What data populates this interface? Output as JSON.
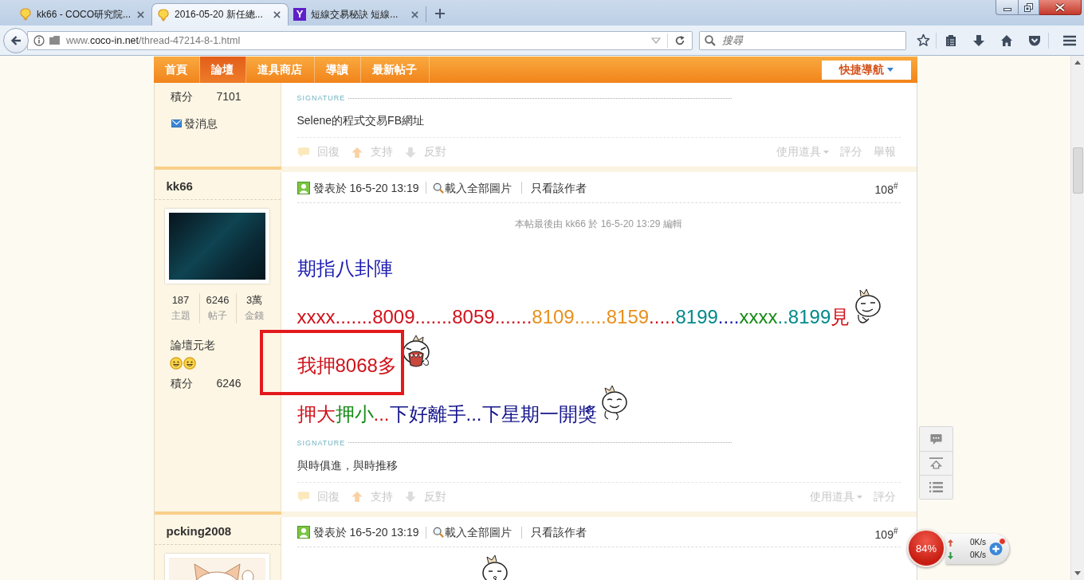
{
  "browser": {
    "tabs": [
      {
        "label": "kk66 - COCO研究院...",
        "selected": false
      },
      {
        "label": "2016-05-20 新任總...",
        "selected": true
      },
      {
        "label": "短線交易秘訣 短線...",
        "selected": false,
        "favicon_letter": "Y"
      }
    ],
    "address": {
      "prefix": "www.",
      "host": "coco-in.net",
      "path": "/thread-47214-8-1.html"
    },
    "search": {
      "placeholder": "搜尋"
    }
  },
  "nav": {
    "items": [
      {
        "label": "首頁",
        "selected": false
      },
      {
        "label": "論壇",
        "selected": true
      },
      {
        "label": "道具商店",
        "selected": false
      },
      {
        "label": "導讀",
        "selected": false
      },
      {
        "label": "最新帖子",
        "selected": false
      }
    ],
    "quick_nav": "快捷導航"
  },
  "posts": [
    {
      "author": {
        "points_label": "積分",
        "points": "7101",
        "message_link": "發消息"
      },
      "signature": {
        "label": "SIGNATURE",
        "text": "Selene的程式交易FB網址"
      },
      "actions": [
        {
          "kind": "reply",
          "label": "回復"
        },
        {
          "kind": "support",
          "label": "支持"
        },
        {
          "kind": "oppose",
          "label": "反對"
        }
      ],
      "tools": [
        {
          "label": "使用道具",
          "menu": true
        },
        {
          "label": "評分",
          "menu": false
        },
        {
          "label": "舉報",
          "menu": false
        }
      ]
    },
    {
      "author": {
        "name": "kk66",
        "avatar": {
          "kind": "photo"
        },
        "stats": [
          {
            "value": "187",
            "label": "主題"
          },
          {
            "value": "6246",
            "label": "帖子"
          },
          {
            "value": "3萬",
            "label": "金錢"
          }
        ],
        "rank": "論壇元老",
        "medals": [
          {
            "kind": "smiley"
          },
          {
            "kind": "smiley"
          }
        ],
        "points_label": "積分",
        "points": "6246"
      },
      "header": {
        "posted": "發表於 16-5-20 13:19",
        "load_images": "載入全部圖片",
        "author_only": "只看該作者",
        "floor": "108$^{#}$"
      },
      "edit_note": "本帖最後由 kk66 於 16-5-20 13:29 編輯",
      "body": [
        {
          "segments": [
            {
              "text": "期指八卦陣",
              "color": "#1a1ab0"
            }
          ],
          "highlighted": false
        },
        {
          "segments": [
            {
              "text": "xxxx.......8009.......8059.......",
              "color": "#d0121b"
            },
            {
              "text": "8109......8159",
              "color": "#e8901e"
            },
            {
              "text": ".....",
              "color": "#d0121b"
            },
            {
              "text": "8199",
              "color": "#008a8a"
            },
            {
              "text": "....",
              "color": "#1a1ab0"
            },
            {
              "text": "xxxx",
              "color": "#168a16"
            },
            {
              "text": "..8199",
              "color": "#008a8a"
            },
            {
              "text": "見",
              "color": "#d0121b"
            }
          ],
          "emoticon": {
            "kind": "smirk"
          },
          "highlighted": false
        },
        {
          "segments": [
            {
              "text": "我押8068多",
              "color": "#d0121b"
            }
          ],
          "emoticon": {
            "kind": "yell"
          },
          "highlighted": true
        },
        {
          "segments": [
            {
              "text": "押大",
              "color": "#d0121b"
            },
            {
              "text": "押小",
              "color": "#168a16"
            },
            {
              "text": "...",
              "color": "#d0121b"
            },
            {
              "text": "下好離手...下星期一開獎",
              "color": "#14148c"
            }
          ],
          "emoticon": {
            "kind": "smile"
          },
          "highlighted": false
        }
      ],
      "signature": {
        "label": "SIGNATURE",
        "text": "與時俱進，與時推移"
      },
      "actions": [
        {
          "kind": "reply",
          "label": "回復"
        },
        {
          "kind": "support",
          "label": "支持"
        },
        {
          "kind": "oppose",
          "label": "反對"
        }
      ],
      "tools": [
        {
          "label": "使用道具",
          "menu": true
        },
        {
          "label": "評分",
          "menu": false
        }
      ]
    },
    {
      "author": {
        "name": "pcking2008",
        "avatar": {
          "kind": "illustration"
        }
      },
      "header": {
        "posted": "發表於 16-5-20 13:19",
        "load_images": "載入全部圖片",
        "author_only": "只看該作者",
        "floor": "109$^{#}$"
      },
      "body": [
        {
          "emoticon": {
            "kind": "whistle"
          },
          "highlighted": false
        }
      ]
    }
  ],
  "net_monitor": {
    "usage": "84%",
    "upload": "0K/s",
    "download": "0K/s"
  }
}
